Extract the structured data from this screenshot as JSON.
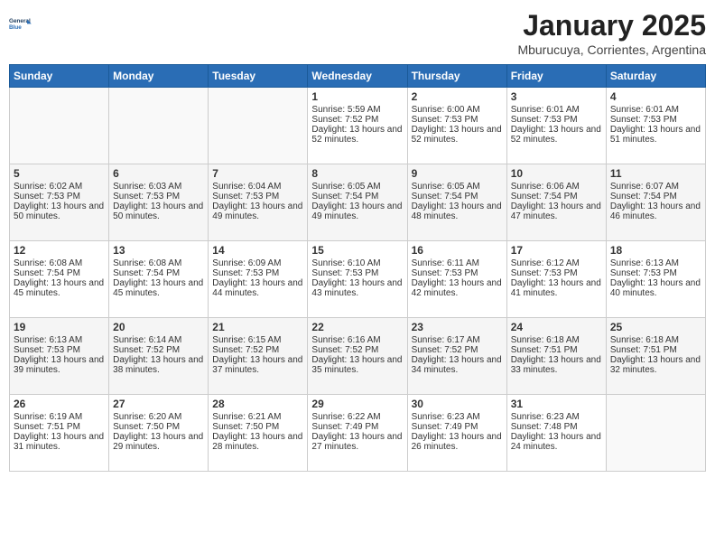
{
  "header": {
    "logo_line1": "General",
    "logo_line2": "Blue",
    "month": "January 2025",
    "location": "Mburucuya, Corrientes, Argentina"
  },
  "days_of_week": [
    "Sunday",
    "Monday",
    "Tuesday",
    "Wednesday",
    "Thursday",
    "Friday",
    "Saturday"
  ],
  "weeks": [
    [
      {
        "day": "",
        "info": ""
      },
      {
        "day": "",
        "info": ""
      },
      {
        "day": "",
        "info": ""
      },
      {
        "day": "1",
        "info": "Sunrise: 5:59 AM\nSunset: 7:52 PM\nDaylight: 13 hours and 52 minutes."
      },
      {
        "day": "2",
        "info": "Sunrise: 6:00 AM\nSunset: 7:53 PM\nDaylight: 13 hours and 52 minutes."
      },
      {
        "day": "3",
        "info": "Sunrise: 6:01 AM\nSunset: 7:53 PM\nDaylight: 13 hours and 52 minutes."
      },
      {
        "day": "4",
        "info": "Sunrise: 6:01 AM\nSunset: 7:53 PM\nDaylight: 13 hours and 51 minutes."
      }
    ],
    [
      {
        "day": "5",
        "info": "Sunrise: 6:02 AM\nSunset: 7:53 PM\nDaylight: 13 hours and 50 minutes."
      },
      {
        "day": "6",
        "info": "Sunrise: 6:03 AM\nSunset: 7:53 PM\nDaylight: 13 hours and 50 minutes."
      },
      {
        "day": "7",
        "info": "Sunrise: 6:04 AM\nSunset: 7:53 PM\nDaylight: 13 hours and 49 minutes."
      },
      {
        "day": "8",
        "info": "Sunrise: 6:05 AM\nSunset: 7:54 PM\nDaylight: 13 hours and 49 minutes."
      },
      {
        "day": "9",
        "info": "Sunrise: 6:05 AM\nSunset: 7:54 PM\nDaylight: 13 hours and 48 minutes."
      },
      {
        "day": "10",
        "info": "Sunrise: 6:06 AM\nSunset: 7:54 PM\nDaylight: 13 hours and 47 minutes."
      },
      {
        "day": "11",
        "info": "Sunrise: 6:07 AM\nSunset: 7:54 PM\nDaylight: 13 hours and 46 minutes."
      }
    ],
    [
      {
        "day": "12",
        "info": "Sunrise: 6:08 AM\nSunset: 7:54 PM\nDaylight: 13 hours and 45 minutes."
      },
      {
        "day": "13",
        "info": "Sunrise: 6:08 AM\nSunset: 7:54 PM\nDaylight: 13 hours and 45 minutes."
      },
      {
        "day": "14",
        "info": "Sunrise: 6:09 AM\nSunset: 7:53 PM\nDaylight: 13 hours and 44 minutes."
      },
      {
        "day": "15",
        "info": "Sunrise: 6:10 AM\nSunset: 7:53 PM\nDaylight: 13 hours and 43 minutes."
      },
      {
        "day": "16",
        "info": "Sunrise: 6:11 AM\nSunset: 7:53 PM\nDaylight: 13 hours and 42 minutes."
      },
      {
        "day": "17",
        "info": "Sunrise: 6:12 AM\nSunset: 7:53 PM\nDaylight: 13 hours and 41 minutes."
      },
      {
        "day": "18",
        "info": "Sunrise: 6:13 AM\nSunset: 7:53 PM\nDaylight: 13 hours and 40 minutes."
      }
    ],
    [
      {
        "day": "19",
        "info": "Sunrise: 6:13 AM\nSunset: 7:53 PM\nDaylight: 13 hours and 39 minutes."
      },
      {
        "day": "20",
        "info": "Sunrise: 6:14 AM\nSunset: 7:52 PM\nDaylight: 13 hours and 38 minutes."
      },
      {
        "day": "21",
        "info": "Sunrise: 6:15 AM\nSunset: 7:52 PM\nDaylight: 13 hours and 37 minutes."
      },
      {
        "day": "22",
        "info": "Sunrise: 6:16 AM\nSunset: 7:52 PM\nDaylight: 13 hours and 35 minutes."
      },
      {
        "day": "23",
        "info": "Sunrise: 6:17 AM\nSunset: 7:52 PM\nDaylight: 13 hours and 34 minutes."
      },
      {
        "day": "24",
        "info": "Sunrise: 6:18 AM\nSunset: 7:51 PM\nDaylight: 13 hours and 33 minutes."
      },
      {
        "day": "25",
        "info": "Sunrise: 6:18 AM\nSunset: 7:51 PM\nDaylight: 13 hours and 32 minutes."
      }
    ],
    [
      {
        "day": "26",
        "info": "Sunrise: 6:19 AM\nSunset: 7:51 PM\nDaylight: 13 hours and 31 minutes."
      },
      {
        "day": "27",
        "info": "Sunrise: 6:20 AM\nSunset: 7:50 PM\nDaylight: 13 hours and 29 minutes."
      },
      {
        "day": "28",
        "info": "Sunrise: 6:21 AM\nSunset: 7:50 PM\nDaylight: 13 hours and 28 minutes."
      },
      {
        "day": "29",
        "info": "Sunrise: 6:22 AM\nSunset: 7:49 PM\nDaylight: 13 hours and 27 minutes."
      },
      {
        "day": "30",
        "info": "Sunrise: 6:23 AM\nSunset: 7:49 PM\nDaylight: 13 hours and 26 minutes."
      },
      {
        "day": "31",
        "info": "Sunrise: 6:23 AM\nSunset: 7:48 PM\nDaylight: 13 hours and 24 minutes."
      },
      {
        "day": "",
        "info": ""
      }
    ]
  ]
}
